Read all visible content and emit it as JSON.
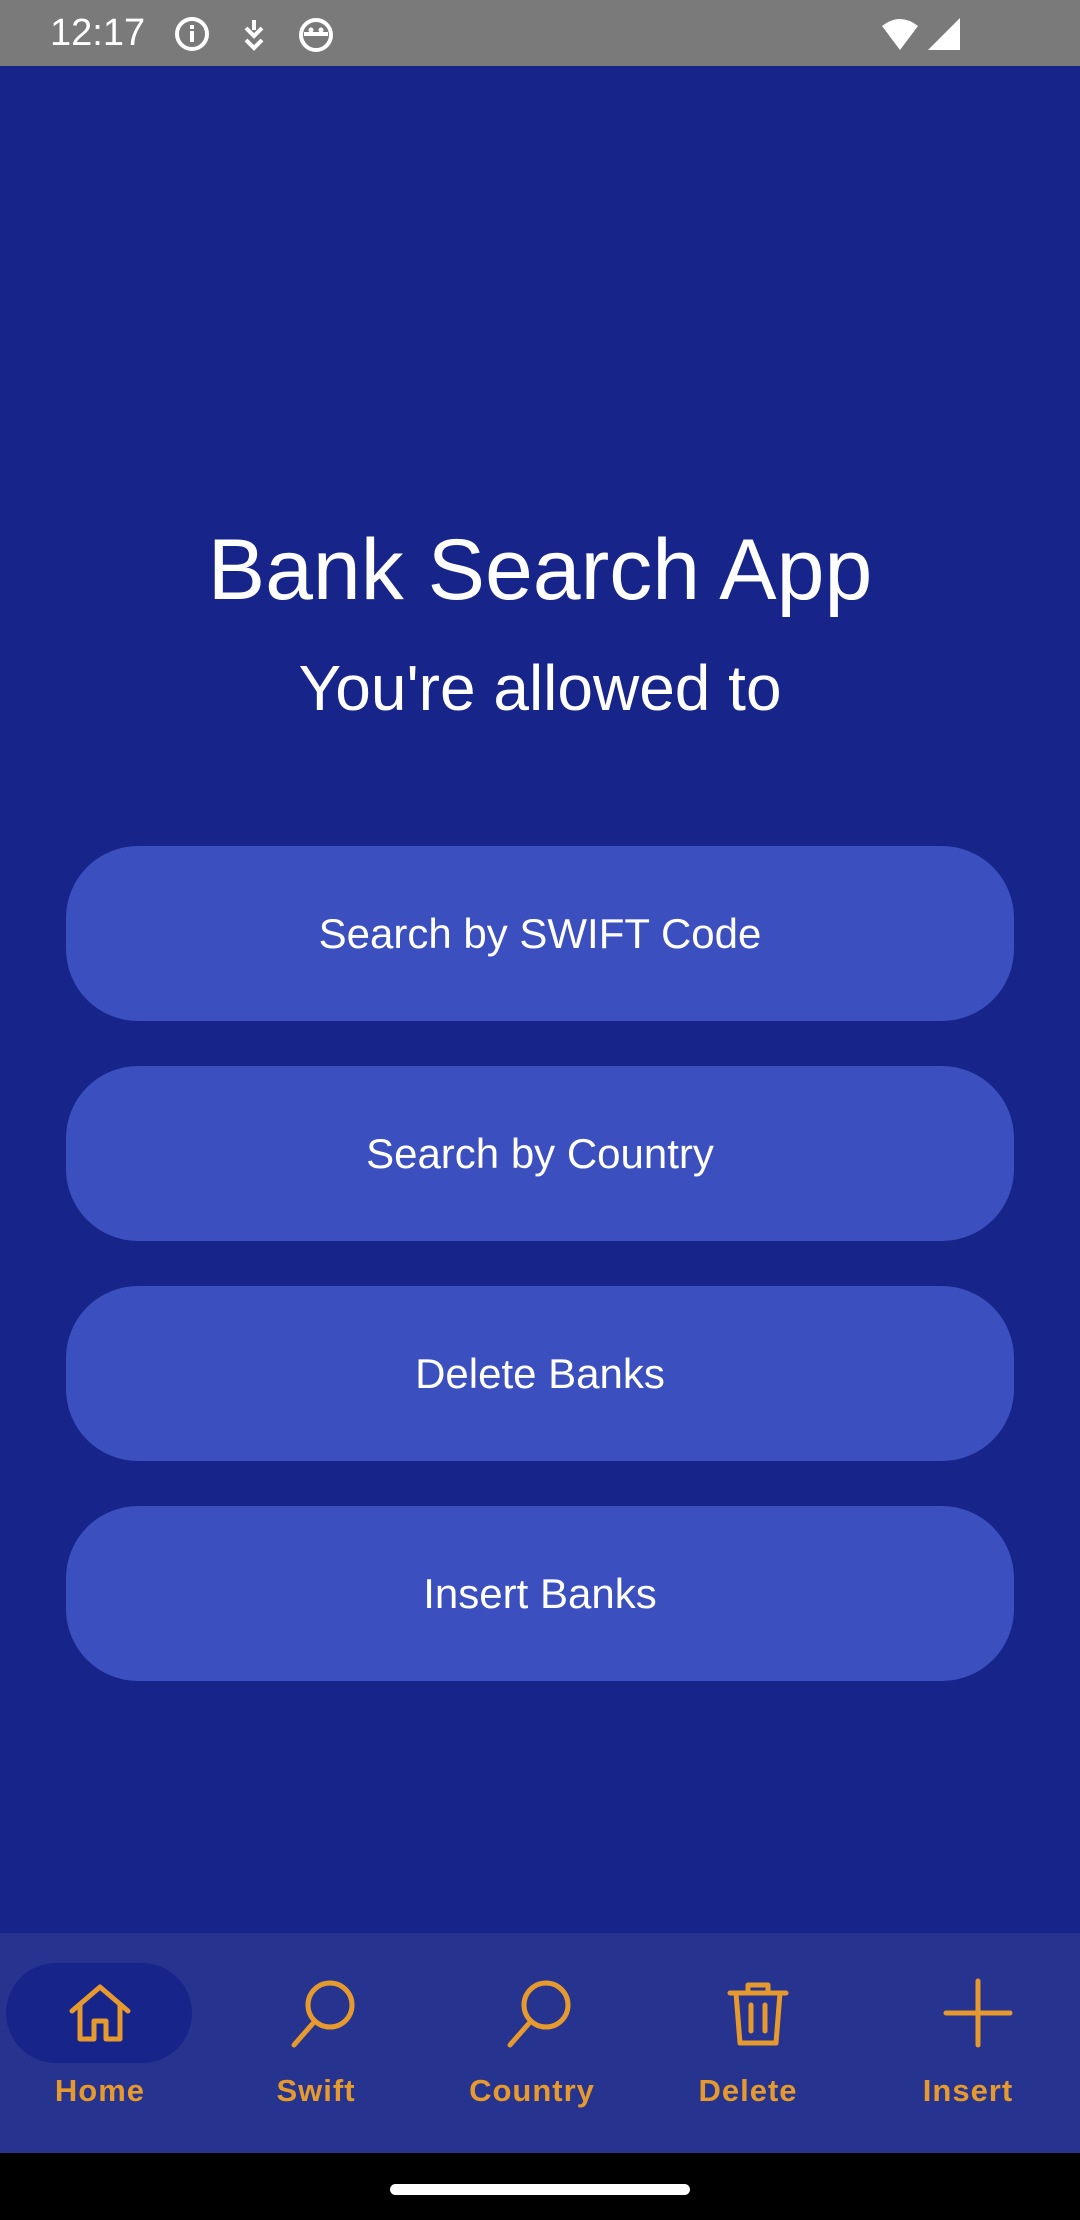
{
  "status_bar": {
    "time": "12:17",
    "icons": [
      "info-icon",
      "download-icon",
      "android-icon",
      "wifi-icon",
      "signal-icon"
    ]
  },
  "main": {
    "title": "Bank Search App",
    "subtitle": "You're allowed to",
    "buttons": [
      {
        "label": "Search by SWIFT Code"
      },
      {
        "label": "Search by Country"
      },
      {
        "label": "Delete Banks"
      },
      {
        "label": "Insert Banks"
      }
    ]
  },
  "bottom_nav": {
    "items": [
      {
        "label": "Home",
        "icon": "home-icon",
        "selected": true
      },
      {
        "label": "Swift",
        "icon": "search-icon",
        "selected": false
      },
      {
        "label": "Country",
        "icon": "search-icon",
        "selected": false
      },
      {
        "label": "Delete",
        "icon": "trash-icon",
        "selected": false
      },
      {
        "label": "Insert",
        "icon": "plus-icon",
        "selected": false
      }
    ]
  },
  "colors": {
    "background": "#17248a",
    "button": "#3b4fbf",
    "nav_background": "#26348f",
    "nav_accent": "#e69a2e",
    "status_bar": "#7a7a7a"
  }
}
